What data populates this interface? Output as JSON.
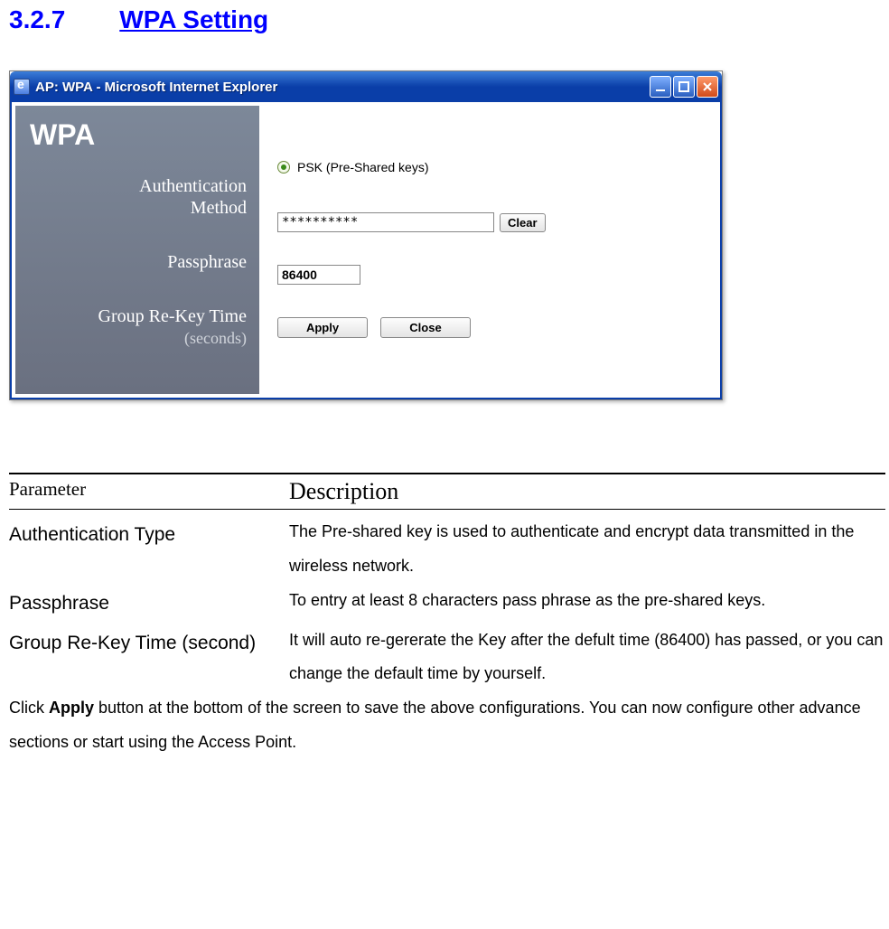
{
  "heading": {
    "number": "3.2.7",
    "title": "WPA Setting"
  },
  "window": {
    "title": "AP: WPA - Microsoft Internet Explorer",
    "sidebar": {
      "heading": "WPA",
      "auth_label_line1": "Authentication",
      "auth_label_line2": "Method",
      "pass_label": "Passphrase",
      "rekey_label_line1": "Group Re-Key Time",
      "rekey_label_line2": "(seconds)"
    },
    "form": {
      "auth_option": "PSK (Pre-Shared keys)",
      "passphrase_value": "**********",
      "clear_label": "Clear",
      "rekey_value": "86400",
      "apply_label": "Apply",
      "close_label": "Close"
    }
  },
  "table": {
    "head_param": "Parameter",
    "head_desc": "Description",
    "rows": [
      {
        "param": "Authentication Type",
        "desc": "The Pre-shared key is used to authenticate and encrypt data transmitted in the wireless network."
      },
      {
        "param": "Passphrase",
        "desc": "To entry at least 8 characters pass phrase as the pre-shared keys."
      },
      {
        "param": "Group Re-Key Time (second)",
        "desc": "It will auto re-gererate the Key after the defult time (86400) has passed, or you can change the default time by yourself."
      }
    ]
  },
  "footnote_before": "Click ",
  "footnote_bold": "Apply",
  "footnote_after": " button at the bottom of the screen to save the above configurations. You can now configure other advance sections or start using the Access Point."
}
